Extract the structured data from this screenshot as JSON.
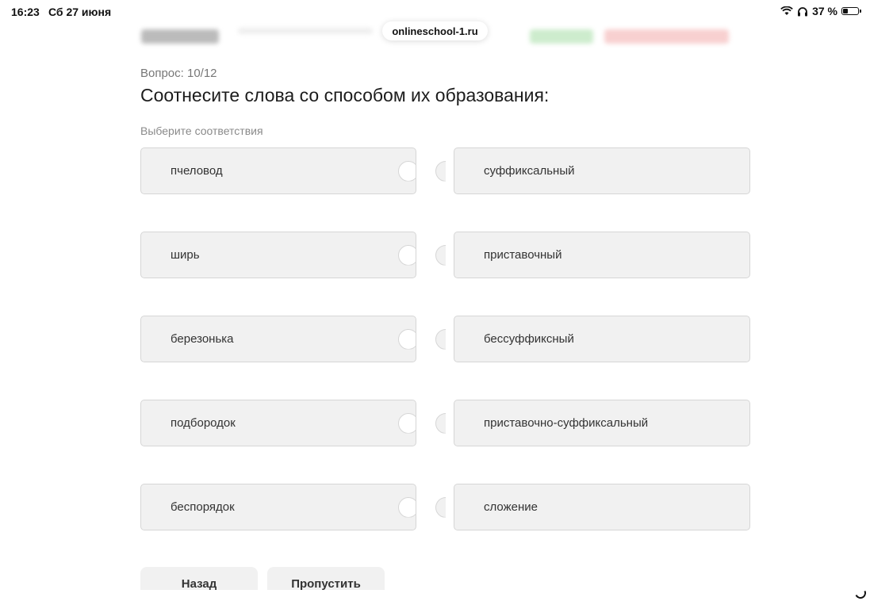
{
  "status_bar": {
    "time": "16:23",
    "date": "Сб 27 июня",
    "battery_label": "37 %",
    "battery_level": 0.37,
    "wifi_icon": "wifi-icon",
    "headphones_icon": "headphones-icon"
  },
  "browser": {
    "url": "onlineschool-1.ru"
  },
  "question": {
    "counter": "Вопрос: 10/12",
    "title": "Соотнесите слова со способом их образования:",
    "hint": "Выберите соответствия"
  },
  "pairs": {
    "left": [
      "пчеловод",
      "ширь",
      "березонька",
      "подбородок",
      "беспорядок"
    ],
    "right": [
      "суффиксальный",
      "приставочный",
      "бессуффиксный",
      "приставочно-суффиксальный",
      "сложение"
    ]
  },
  "buttons": {
    "back": "Назад",
    "skip": "Пропустить"
  },
  "colors": {
    "piece_bg": "#f1f1f1",
    "piece_border": "#d6d6d6",
    "accent_green": "#cdeccd",
    "accent_red": "#f8d0d0"
  }
}
